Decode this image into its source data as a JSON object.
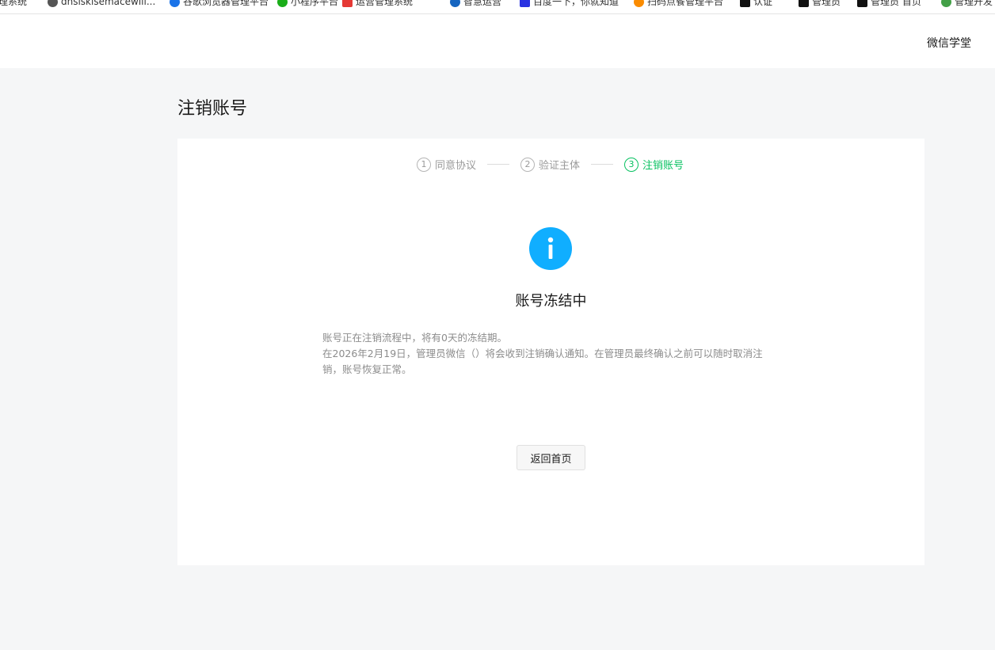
{
  "bookmarks": [
    {
      "label": "理系统",
      "color": "#888888",
      "icon": "page-icon"
    },
    {
      "label": "dnsiskisemacewill...",
      "color": "#555555",
      "icon": "globe-icon"
    },
    {
      "label": "谷歌浏览器管理平台",
      "color": "#1a73e8",
      "icon": "globe-icon"
    },
    {
      "label": "小程序平台",
      "color": "#1aad19",
      "icon": "leaf-icon"
    },
    {
      "label": "运营管理系统",
      "color": "#e53935",
      "icon": "app-icon"
    },
    {
      "label": "智慧运营",
      "color": "#1565c0",
      "icon": "globe-icon"
    },
    {
      "label": "百度一下，你就知道",
      "color": "#2932e1",
      "icon": "baidu-icon"
    },
    {
      "label": "扫码点餐管理平台",
      "color": "#fb8c00",
      "icon": "app-icon"
    },
    {
      "label": "认证",
      "color": "#111111",
      "icon": "k-icon"
    },
    {
      "label": "管理员",
      "color": "#111111",
      "icon": "k-icon"
    },
    {
      "label": "管理员 首页",
      "color": "#111111",
      "icon": "k-icon"
    },
    {
      "label": "管理开发",
      "color": "#43a047",
      "icon": "app-icon"
    }
  ],
  "topbar": {
    "nav_link": "微信学堂"
  },
  "page": {
    "title": "注销账号"
  },
  "steps": [
    {
      "num": "1",
      "label": "同意协议",
      "active": false
    },
    {
      "num": "2",
      "label": "验证主体",
      "active": false
    },
    {
      "num": "3",
      "label": "注销账号",
      "active": true
    }
  ],
  "status": {
    "icon": "info-icon",
    "icon_color": "#10aeff",
    "title": "账号冻结中",
    "lines": [
      "账号正在注销流程中，将有0天的冻结期。",
      "在2026年2月19日，管理员微信（）将会收到注销确认通知。在管理员最终确认之前可以随时取消注销，账号恢复正常。"
    ]
  },
  "actions": {
    "back_home": "返回首页"
  },
  "colors": {
    "active_step": "#07c160",
    "background": "#f5f6f7"
  }
}
